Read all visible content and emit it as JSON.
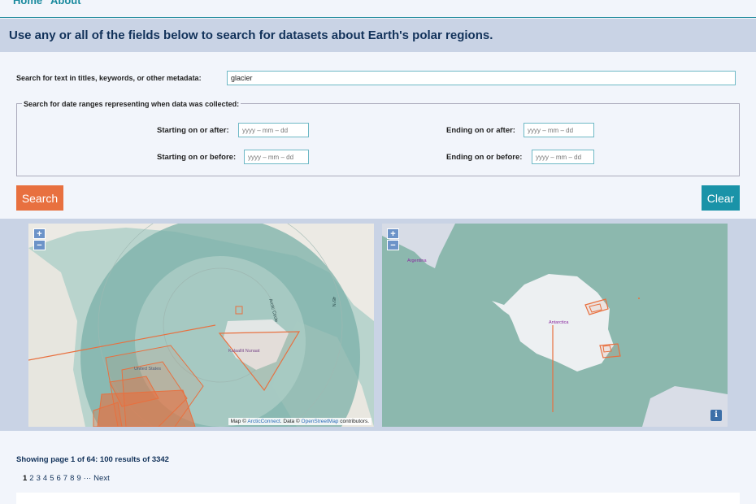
{
  "nav": {
    "home": "Home",
    "about": "About"
  },
  "banner": {
    "title": "Use any or all of the fields below to search for datasets about Earth's polar regions."
  },
  "search": {
    "text_label": "Search for text in titles, keywords, or other metadata:",
    "text_value": "glacier",
    "date_legend": "Search for date ranges representing when data was collected:",
    "start_after_label": "Starting on or after:",
    "start_before_label": "Starting on or before:",
    "end_after_label": "Ending on or after:",
    "end_before_label": "Ending on or before:",
    "date_placeholder": "yyyy – mm – dd",
    "search_button": "Search",
    "clear_button": "Clear"
  },
  "maps": {
    "zoom_in": "+",
    "zoom_out": "−",
    "arctic": {
      "attr_prefix": "Map © ",
      "attr_link1": "ArcticConnect",
      "attr_mid": ". Data © ",
      "attr_link2": "OpenStreetMap",
      "attr_suffix": " contributors.",
      "label_greenland": "Kalaallit Nunaat",
      "label_us": "United States",
      "label_circle": "Arctic Circle",
      "label_meridian": "45°N"
    },
    "antarctic": {
      "label_argentina": "Argentina",
      "label_antarctica": "Antarctica",
      "info": "i"
    }
  },
  "results": {
    "summary": "Showing page 1 of 64: 100 results of 3342",
    "pages": [
      "1",
      "2",
      "3",
      "4",
      "5",
      "6",
      "7",
      "8",
      "9"
    ],
    "ellipsis": "···",
    "next": "Next"
  }
}
